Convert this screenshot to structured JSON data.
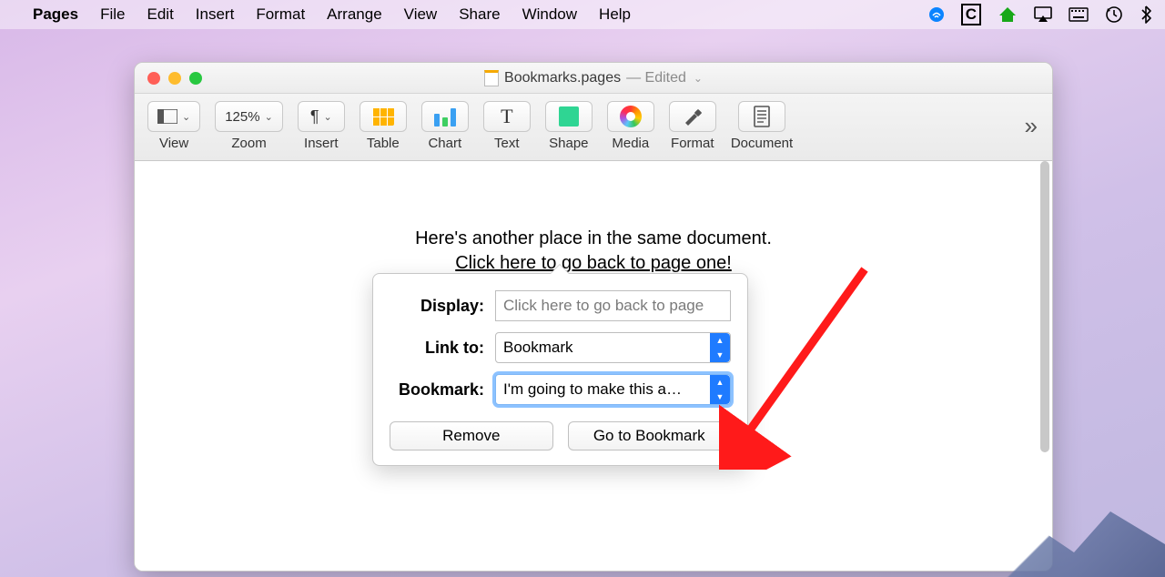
{
  "menubar": {
    "app": "Pages",
    "items": [
      "File",
      "Edit",
      "Insert",
      "Format",
      "Arrange",
      "View",
      "Share",
      "Window",
      "Help"
    ]
  },
  "window": {
    "filename": "Bookmarks.pages",
    "status": "— Edited"
  },
  "toolbar": {
    "view": "View",
    "zoom_value": "125%",
    "zoom": "Zoom",
    "insert": "Insert",
    "table": "Table",
    "chart": "Chart",
    "text": "Text",
    "shape": "Shape",
    "media": "Media",
    "format": "Format",
    "document": "Document"
  },
  "page": {
    "line1": "Here's another place in the same document.",
    "link": "Click here to go back to page one!"
  },
  "popover": {
    "display_label": "Display:",
    "display_value": "Click here to go back to page",
    "linkto_label": "Link to:",
    "linkto_value": "Bookmark",
    "bookmark_label": "Bookmark:",
    "bookmark_value": "I'm going to make this a…",
    "remove": "Remove",
    "goto": "Go to Bookmark"
  }
}
